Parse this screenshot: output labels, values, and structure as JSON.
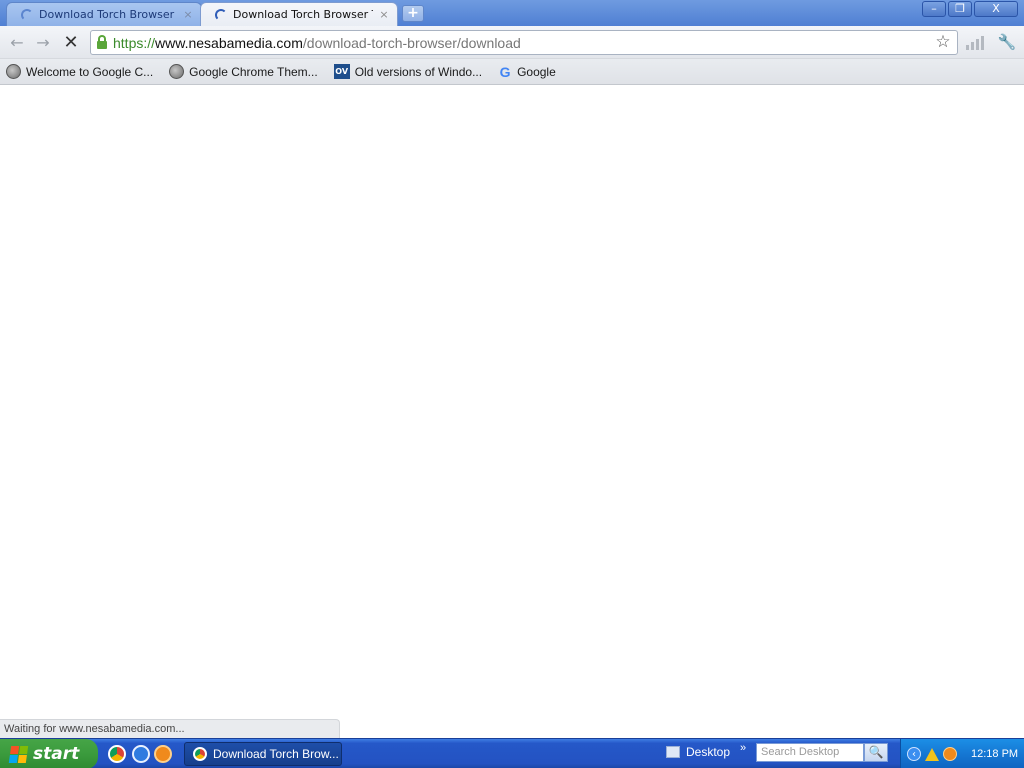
{
  "tabs": [
    {
      "title": "Download Torch Browser Terb",
      "close": "×",
      "state": "loading"
    },
    {
      "title": "Download Torch Browser Terb",
      "close": "×",
      "state": "loading-active"
    }
  ],
  "new_tab_label": "+",
  "window_controls": {
    "minimize": "–",
    "restore": "❐",
    "close": "X"
  },
  "toolbar": {
    "back_icon": "back-arrow-icon",
    "forward_icon": "forward-arrow-icon",
    "stop_label": "✕",
    "url": {
      "scheme": "https://",
      "host": "www.nesabamedia.com",
      "path": "/download-torch-browser/download"
    },
    "star_label": "☆",
    "wrench_label": "🔧"
  },
  "bookmarks": [
    {
      "label": "Welcome to Google C...",
      "icon": "globe-icon"
    },
    {
      "label": "Google Chrome Them...",
      "icon": "globe-icon"
    },
    {
      "label": "Old versions of Windo...",
      "icon": "ov-icon",
      "icon_text": "OV"
    },
    {
      "label": "Google",
      "icon": "google-g-icon",
      "icon_text": "G"
    }
  ],
  "status_text": "Waiting for www.nesabamedia.com...",
  "taskbar": {
    "start_label": "start",
    "task_label": "Download Torch Brow...",
    "desktop_label": "Desktop",
    "chevron": "»",
    "search_placeholder": "Search Desktop",
    "search_button": "🔍",
    "tray_arrow": "‹",
    "clock": "12:18 PM"
  },
  "colors": {
    "titlebar": "#5585d6",
    "taskbar": "#2352c2",
    "start": "#3b9b3d",
    "secure_green": "#3a8a2a"
  }
}
